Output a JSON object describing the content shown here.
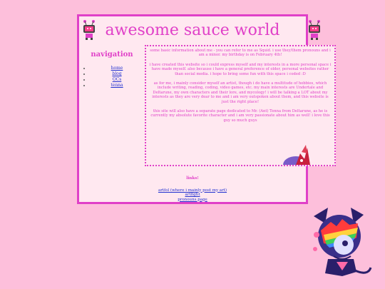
{
  "header": {
    "title": "awesome sauce world"
  },
  "navigation": {
    "title": "navigation",
    "items": [
      "home",
      "blog",
      "OCs",
      "tenna"
    ]
  },
  "content": {
    "paragraphs": [
      "some basic information about me - you can refer to me as Squid. i use they/them pronouns and i am a minor. my birthday is on February 4th!",
      "i have created this website so i could express myself and my interests in a more personal space i have made myself. also because i have a general preference of older, personal websites rather than social media. i hope to bring some fun with this space i coded :D",
      "as for me, i mainly consider myself an artist, though i do have a multitude of hobbies, which include writing, reading, coding, video games, etc. my main interests are Undertale and Deltarune, my own characters and their lore, and mycology! i will be talking a LOT about my interests as they are very dear to me and i am very outspoken about them, and this website is just the right place!",
      "this site will also have a separate page dedicated to Mr. (Ant) Tenna from Deltarune, as he is currently my absolute favorite character and i am very passionate about him as well! i love this guy so much guys"
    ]
  },
  "footer": {
    "links_title": "links!",
    "links": [
      "artfol (where i mainly post my art)",
      "artfight",
      "pronouns.page"
    ]
  },
  "colors": {
    "background": "#fdbfdb",
    "accent": "#e040c8",
    "panel": "#ffe8f0",
    "link": "#2030d0"
  }
}
